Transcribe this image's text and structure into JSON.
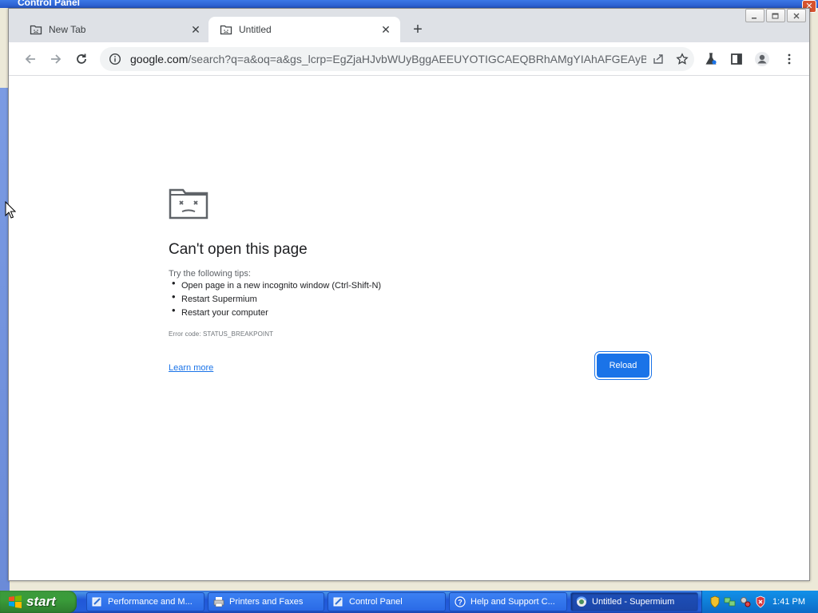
{
  "background_window": {
    "title": "Control Panel"
  },
  "browser": {
    "tabs": [
      {
        "label": "New Tab",
        "active": false
      },
      {
        "label": "Untitled",
        "active": true
      }
    ],
    "new_tab_symbol": "+",
    "address": {
      "host": "google.com",
      "path": "/search?q=a&oq=a&gs_lcrp=EgZjaHJvbWUyBggAEEUYOTIGCAEQBRhAMgYIAhAFGEAyBgg..."
    }
  },
  "error_page": {
    "title": "Can't open this page",
    "tips_intro": "Try the following tips:",
    "tips": [
      "Open page in a new incognito window (Ctrl-Shift-N)",
      "Restart Supermium",
      "Restart your computer"
    ],
    "error_code": "Error code: STATUS_BREAKPOINT",
    "learn_more": "Learn more",
    "reload": "Reload"
  },
  "taskbar": {
    "start_label": "start",
    "tasks": [
      {
        "label": "Performance and M...",
        "icon": "control-panel-icon"
      },
      {
        "label": "Printers and Faxes",
        "icon": "printer-icon"
      },
      {
        "label": "Control Panel",
        "icon": "control-panel-icon"
      },
      {
        "label": "Help and Support C...",
        "icon": "help-icon"
      },
      {
        "label": "Untitled - Supermium",
        "icon": "supermium-icon",
        "active": true
      }
    ],
    "clock": "1:41 PM"
  },
  "colors": {
    "accent": "#1a73e8",
    "xp_taskbar": "#245edb",
    "xp_start": "#3a9c3a"
  }
}
